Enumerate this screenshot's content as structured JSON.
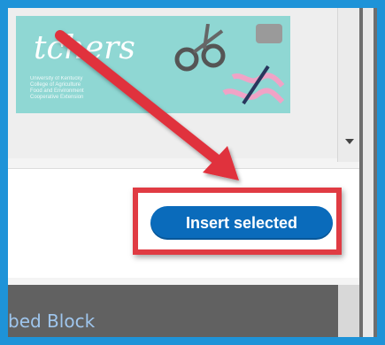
{
  "thumbnail": {
    "script_text": "tchers",
    "caption_lines": [
      "University of Kentucky",
      "College of Agriculture",
      "Food and Environment",
      "Cooperative Extension"
    ]
  },
  "dialog": {
    "insert_label": "Insert selected"
  },
  "lower_panel": {
    "label": "bed Block"
  },
  "colors": {
    "frame": "#1e93d8",
    "button": "#0a6bbb",
    "highlight": "#e03b43",
    "thumbnail_bg": "#8fd7d3"
  },
  "icons": [
    "scroll-down-icon",
    "scissors-icon",
    "thimble-icon",
    "annotation-arrow"
  ]
}
